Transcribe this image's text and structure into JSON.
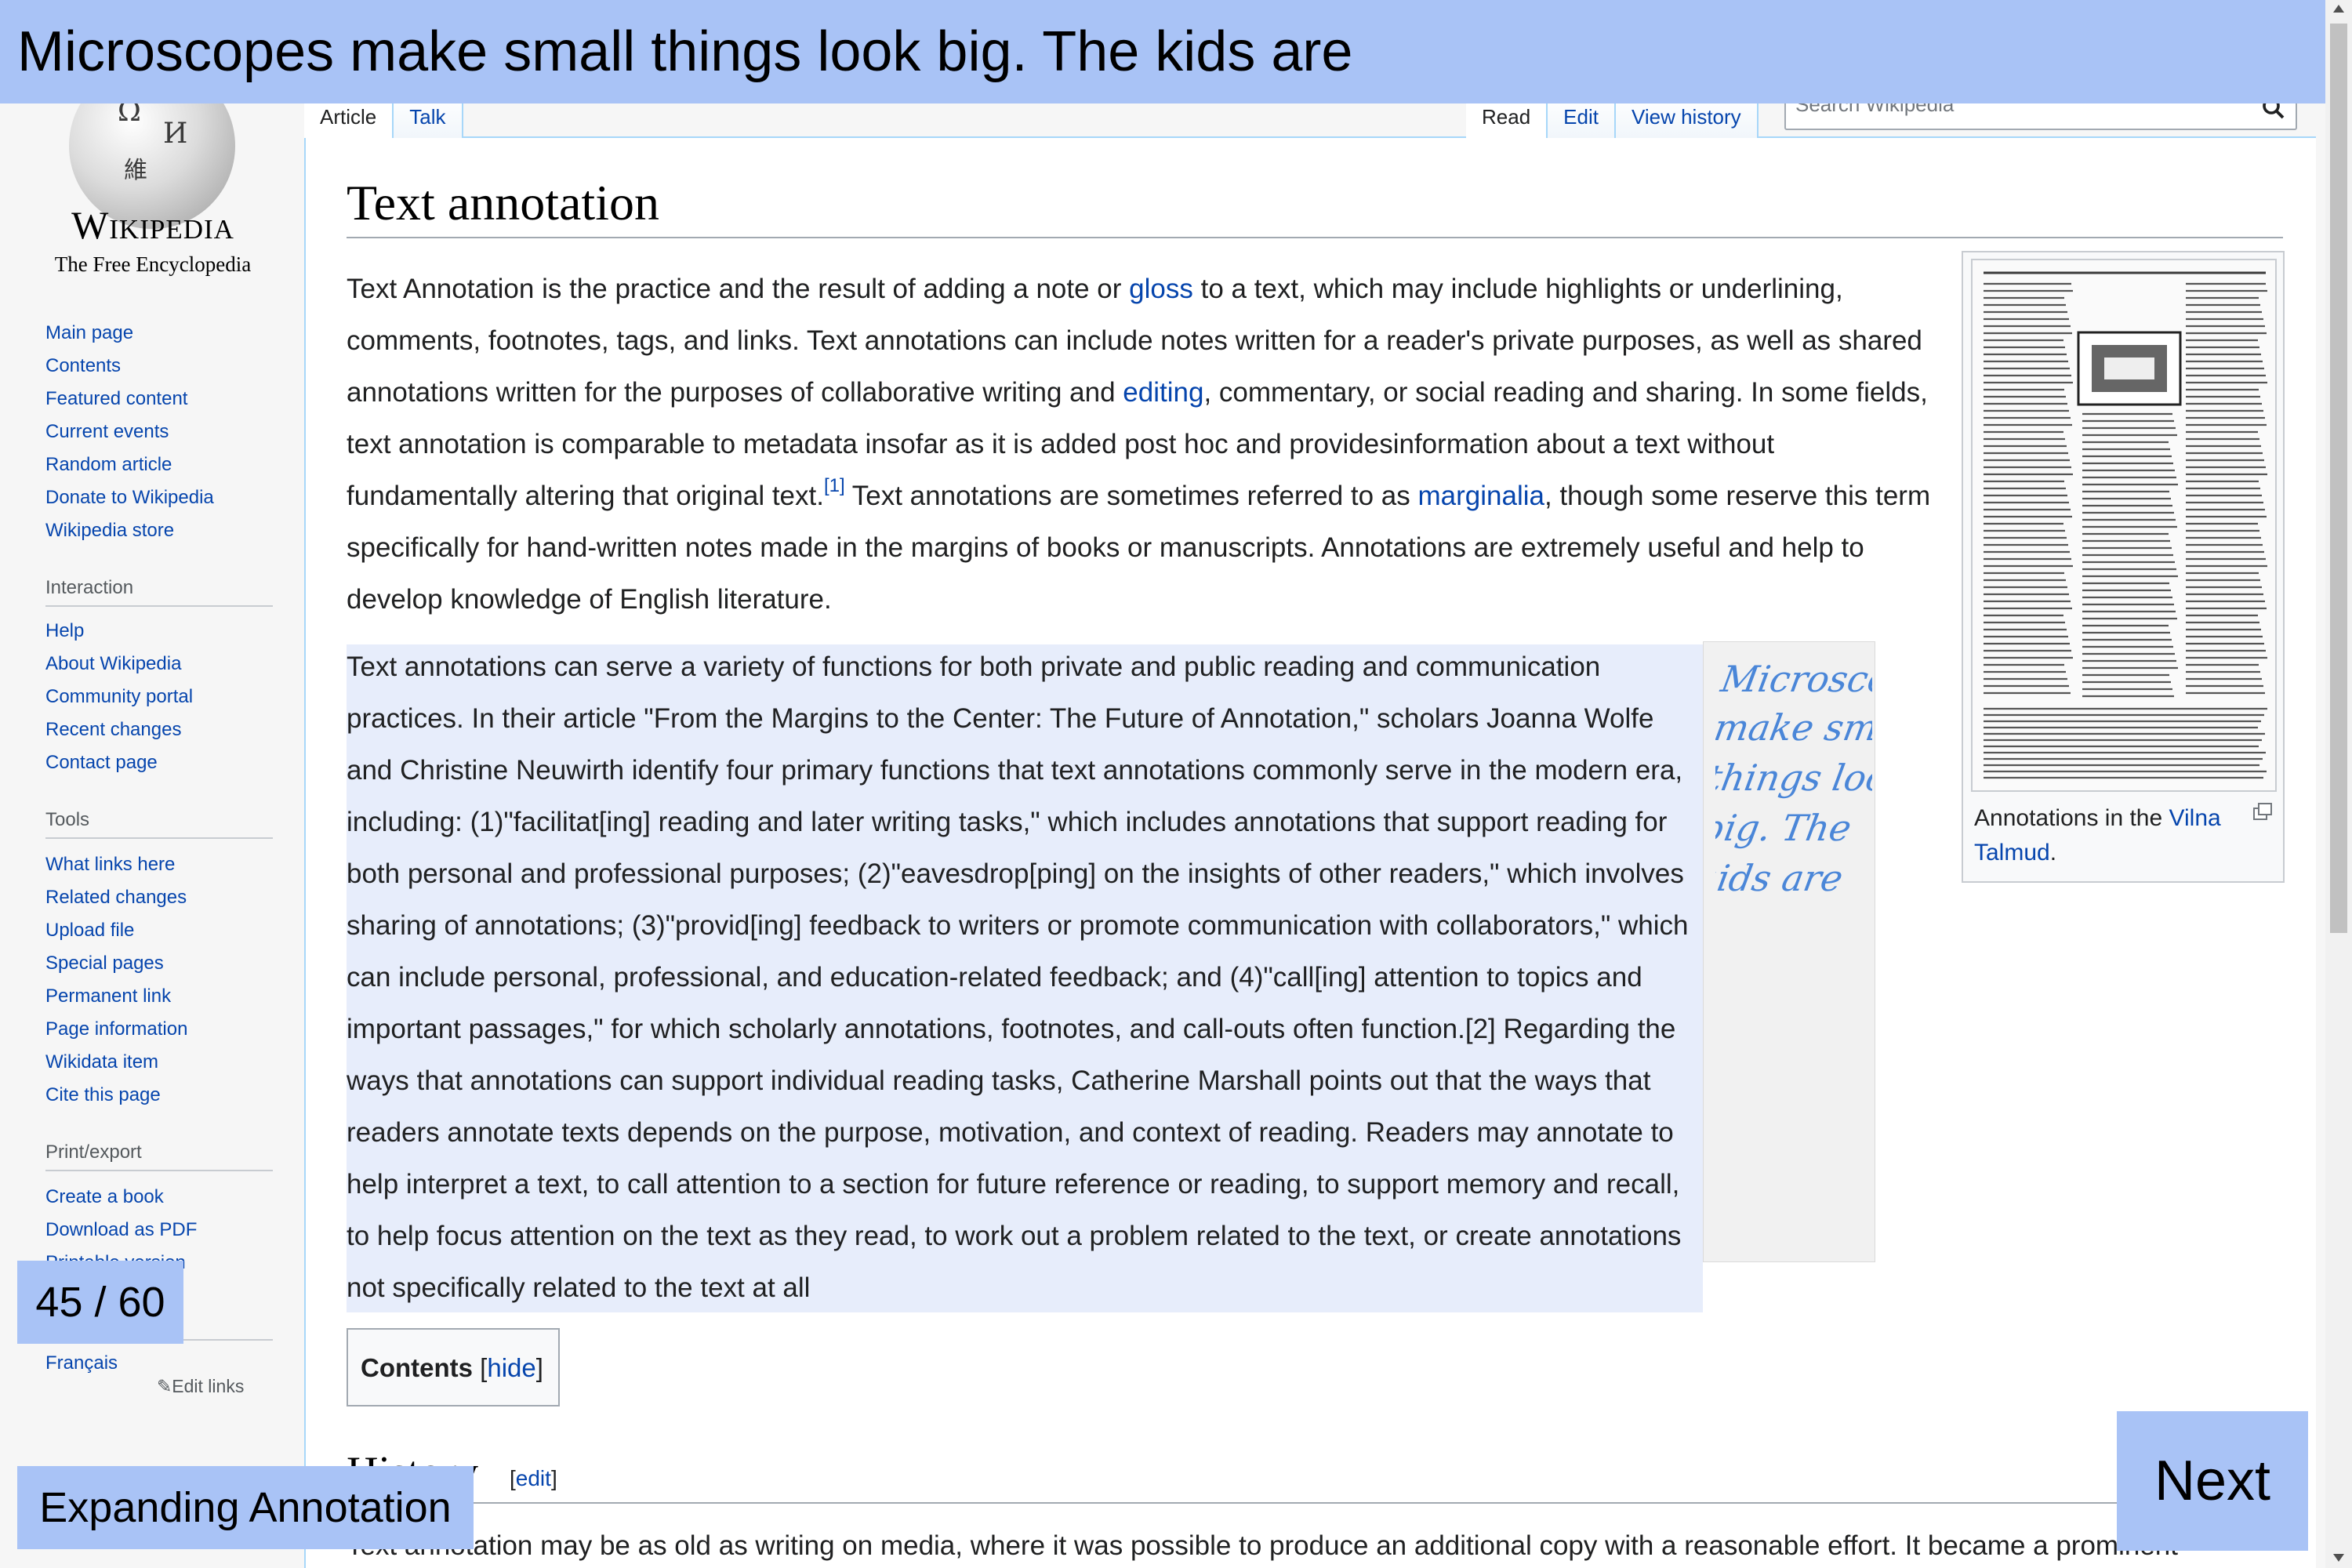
{
  "logo": {
    "wordmark": "Wikipedia",
    "tagline": "The Free Encyclopedia"
  },
  "sidebar": {
    "nav": [
      "Main page",
      "Contents",
      "Featured content",
      "Current events",
      "Random article",
      "Donate to Wikipedia",
      "Wikipedia store"
    ],
    "interaction_heading": "Interaction",
    "interaction": [
      "Help",
      "About Wikipedia",
      "Community portal",
      "Recent changes",
      "Contact page"
    ],
    "tools_heading": "Tools",
    "tools": [
      "What links here",
      "Related changes",
      "Upload file",
      "Special pages",
      "Permanent link",
      "Page information",
      "Wikidata item",
      "Cite this page"
    ],
    "print_heading": "Print/export",
    "print": [
      "Create a book",
      "Download as PDF",
      "Printable version"
    ],
    "language": "Français",
    "edit_links": "Edit links"
  },
  "tabs": {
    "article": "Article",
    "talk": "Talk",
    "read": "Read",
    "edit": "Edit",
    "history": "View history"
  },
  "search": {
    "placeholder": "Search Wikipedia"
  },
  "article": {
    "title": "Text annotation",
    "p1": {
      "t1": "Text Annotation is the practice and the result of adding a note or ",
      "l1": "gloss",
      "t2": " to a text, which may include highlights or underlining, comments, footnotes, tags, and links. Text annotations can include notes written for a reader's private purposes, as well as shared annotations written for the purposes of collaborative writing and ",
      "l2": "editing",
      "t3": ", commentary, or social reading and sharing. In some fields, text annotation is comparable to metadata insofar as it is added post hoc and providesinformation about a text without fundamentally altering that original text.",
      "ref": "[1]",
      "t4": " Text annotations are sometimes referred to as ",
      "l3": "marginalia",
      "t5": ", though some reserve this term specifically for hand-written notes made in the margins of books or manuscripts. Annotations are extremely useful and help to develop knowledge of English literature."
    },
    "p2": "Text annotations can serve a variety of functions for both private and public reading and communication practices. In their article \"From the Margins to the Center: The Future of Annotation,\" scholars Joanna Wolfe and Christine Neuwirth identify four primary functions that text annotations commonly serve in the modern era, including: (1)\"facilitat[ing] reading and later writing tasks,\" which includes annotations that support reading for both personal and professional purposes; (2)\"eavesdrop[ping] on the insights of other readers,\" which involves sharing of annotations; (3)\"provid[ing] feedback to writers or promote communication with collaborators,\" which can include personal, professional, and education-related feedback; and (4)\"call[ing] attention to topics and important passages,\" for which scholarly annotations, footnotes, and call-outs often function.[2] Regarding the ways that annotations can support individual reading tasks, Catherine Marshall points out that the ways that readers annotate texts depends on the purpose, motivation, and context of reading. Readers may annotate to help interpret a text, to call attention to a section for future reference or reading, to support memory and recall, to help focus attention on the text as they read, to work out a problem related to the text, or create annotations not specifically related to the text at all",
    "handnote": [
      "Microscopes",
      "make small",
      "things look",
      "big. The",
      "kids are"
    ],
    "thumb_caption": {
      "t": "Annotations in the ",
      "link": "Vilna Talmud",
      "end": "."
    },
    "toc": {
      "title": "Contents",
      "lb": "[",
      "hide": "hide",
      "rb": "]"
    },
    "history": {
      "heading": "History",
      "lb": "[",
      "edit": "edit",
      "rb": "]"
    },
    "last_line": "Text annotation may be as old as writing on media, where it was possible to produce an additional copy with a reasonable effort. It became a prominent"
  },
  "overlay": {
    "banner": "Microscopes make small things look big. The kids are",
    "pager": "45 / 60",
    "mode_button": "Expanding Annotation",
    "next_button": "Next"
  },
  "colors": {
    "overlay": "#a9c3f6",
    "highlight": "#e7edfb",
    "link": "#0645ad",
    "handwriting": "#4a86d8"
  }
}
